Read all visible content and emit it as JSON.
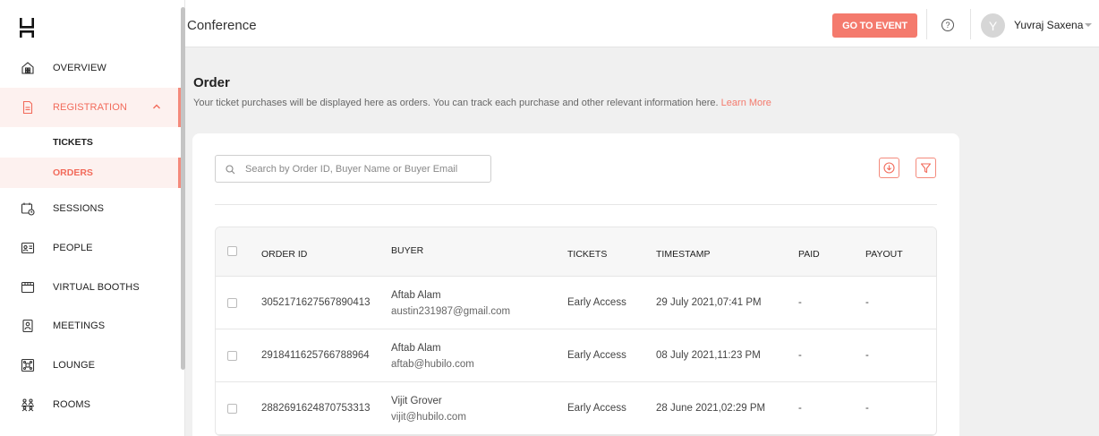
{
  "header": {
    "title": "Conference",
    "go_to_event": "GO TO EVENT",
    "help_glyph": "?",
    "user": {
      "initial": "Y",
      "name": "Yuvraj Saxena"
    }
  },
  "sidebar": {
    "items": [
      {
        "label": "OVERVIEW",
        "icon": "overview-icon"
      },
      {
        "label": "REGISTRATION",
        "icon": "registration-icon",
        "active": true,
        "expanded": true
      },
      {
        "label": "SESSIONS",
        "icon": "sessions-icon"
      },
      {
        "label": "PEOPLE",
        "icon": "people-icon"
      },
      {
        "label": "VIRTUAL BOOTHS",
        "icon": "virtual-booths-icon"
      },
      {
        "label": "MEETINGS",
        "icon": "meetings-icon"
      },
      {
        "label": "LOUNGE",
        "icon": "lounge-icon"
      },
      {
        "label": "ROOMS",
        "icon": "rooms-icon"
      }
    ],
    "sub_items": [
      {
        "label": "TICKETS"
      },
      {
        "label": "ORDERS",
        "active": true
      }
    ]
  },
  "main": {
    "title": "Order",
    "description": "Your ticket purchases will be displayed here as orders. You can track each purchase and other relevant information here.",
    "learn_more": "Learn More",
    "search": {
      "placeholder": "Search by Order ID, Buyer Name or Buyer Email",
      "value": ""
    },
    "table": {
      "columns": [
        "ORDER ID",
        "BUYER",
        "TICKETS",
        "TIMESTAMP",
        "PAID",
        "PAYOUT"
      ],
      "rows": [
        {
          "order_id": "3052171627567890413",
          "buyer_name": "Aftab Alam",
          "buyer_email": "austin231987@gmail.com",
          "tickets": "Early Access",
          "timestamp": "29 July 2021,07:41 PM",
          "paid": "-",
          "payout": "-"
        },
        {
          "order_id": "2918411625766788964",
          "buyer_name": "Aftab Alam",
          "buyer_email": "aftab@hubilo.com",
          "tickets": "Early Access",
          "timestamp": "08 July 2021,11:23 PM",
          "paid": "-",
          "payout": "-"
        },
        {
          "order_id": "2882691624870753313",
          "buyer_name": "Vijit Grover",
          "buyer_email": "vijit@hubilo.com",
          "tickets": "Early Access",
          "timestamp": "28 June 2021,02:29 PM",
          "paid": "-",
          "payout": "-"
        }
      ]
    }
  },
  "colors": {
    "accent": "#f47a6d",
    "active_bg": "#fdf1ef"
  }
}
